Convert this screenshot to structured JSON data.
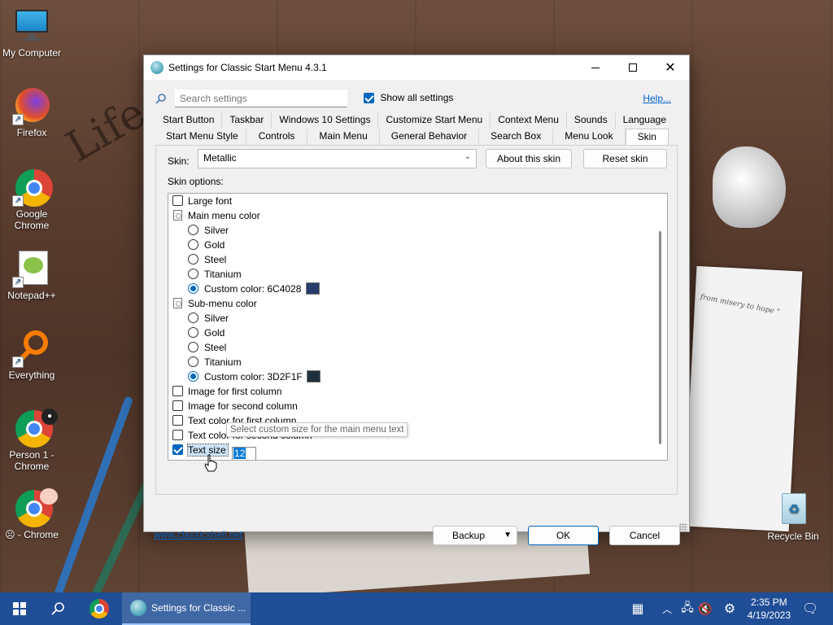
{
  "desktop": {
    "icons": [
      {
        "label": "My Computer",
        "icon": "monitor-icon"
      },
      {
        "label": "Firefox",
        "icon": "firefox-icon"
      },
      {
        "label": "Google Chrome",
        "icon": "chrome-icon"
      },
      {
        "label": "Notepad++",
        "icon": "notepadpp-icon"
      },
      {
        "label": "Everything",
        "icon": "search-magnifier-icon"
      },
      {
        "label": "Person 1 - Chrome",
        "icon": "chrome-person-icon"
      },
      {
        "label": "☹ - Chrome",
        "icon": "chrome-glasses-icon"
      },
      {
        "label": "Recycle Bin",
        "icon": "recycle-bin-icon"
      }
    ],
    "wallpaper_text": [
      "Life",
      "from misery to hope \""
    ]
  },
  "dialog": {
    "title": "Settings for Classic Start Menu 4.3.1",
    "search": {
      "placeholder": "Search settings",
      "value": ""
    },
    "show_all_label": "Show all settings",
    "show_all_checked": true,
    "help_label": "Help...",
    "tabs_row1": [
      "Start Button",
      "Taskbar",
      "Windows 10 Settings",
      "Customize Start Menu",
      "Context Menu",
      "Sounds",
      "Language"
    ],
    "tabs_row2": [
      "Start Menu Style",
      "Controls",
      "Main Menu",
      "General Behavior",
      "Search Box",
      "Menu Look",
      "Skin"
    ],
    "active_tab": "Skin",
    "skin": {
      "label": "Skin:",
      "selected": "Metallic",
      "about_button": "About this skin",
      "reset_button": "Reset skin",
      "options_label": "Skin options:"
    },
    "options": {
      "large_font": "Large font",
      "main_menu_color": "Main menu color",
      "main_silver": "Silver",
      "main_gold": "Gold",
      "main_steel": "Steel",
      "main_titanium": "Titanium",
      "main_custom": "Custom color: 6C4028",
      "main_custom_swatch": "#283c6c",
      "sub_menu_color": "Sub-menu color",
      "sub_silver": "Silver",
      "sub_gold": "Gold",
      "sub_steel": "Steel",
      "sub_titanium": "Titanium",
      "sub_custom": "Custom color: 3D2F1F",
      "sub_custom_swatch": "#1f2f3d",
      "image_first": "Image for first column",
      "image_second": "Image for second column",
      "text_color_first": "Text color for first column",
      "text_color_second": "Text color for second column",
      "text_size": "Text size",
      "text_size_value": "12",
      "text_size_checked": true
    },
    "tooltip": "Select custom size for the main menu text",
    "footer_link": "www.classicshell.net",
    "backup_button": "Backup",
    "ok_button": "OK",
    "cancel_button": "Cancel"
  },
  "taskbar": {
    "app_label": "Settings for Classic ...",
    "time": "2:35 PM",
    "date": "4/19/2023",
    "color": "#1f4e96"
  }
}
